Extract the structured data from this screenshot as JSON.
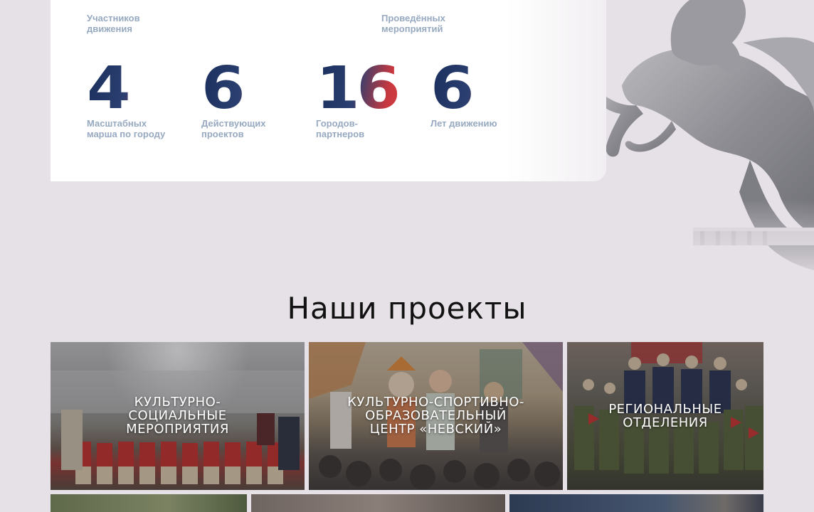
{
  "stats": {
    "top_labels": [
      {
        "text": "Участников\nдвижения"
      },
      {
        "text": "Проведённых\nмероприятий"
      }
    ],
    "items": [
      {
        "value": "4",
        "label": "Масштабных\nмарша по городу"
      },
      {
        "value": "6",
        "label": "Действующих\nпроектов"
      },
      {
        "value": "16",
        "label": "Городов-\nпартнеров"
      },
      {
        "value": "6",
        "label": "Лет движению"
      }
    ]
  },
  "projects": {
    "title": "Наши проекты",
    "cards": [
      {
        "title": "КУЛЬТУРНО-\nСОЦИАЛЬНЫЕ\nМЕРОПРИЯТИЯ"
      },
      {
        "title": "КУЛЬТУРНО-СПОРТИВНО-\nОБРАЗОВАТЕЛЬНЫЙ\nЦЕНТР «НЕВСКИЙ»"
      },
      {
        "title": "РЕГИОНАЛЬНЫЕ\nОТДЕЛЕНИЯ"
      }
    ]
  },
  "colors": {
    "background": "#e6e1e6",
    "card": "#ffffff",
    "label": "#97a9c0",
    "gradient_blue": "#1b2f5e",
    "gradient_red": "#e8483f",
    "title": "#121212"
  },
  "icons": [
    "horse-statue-decoration"
  ]
}
